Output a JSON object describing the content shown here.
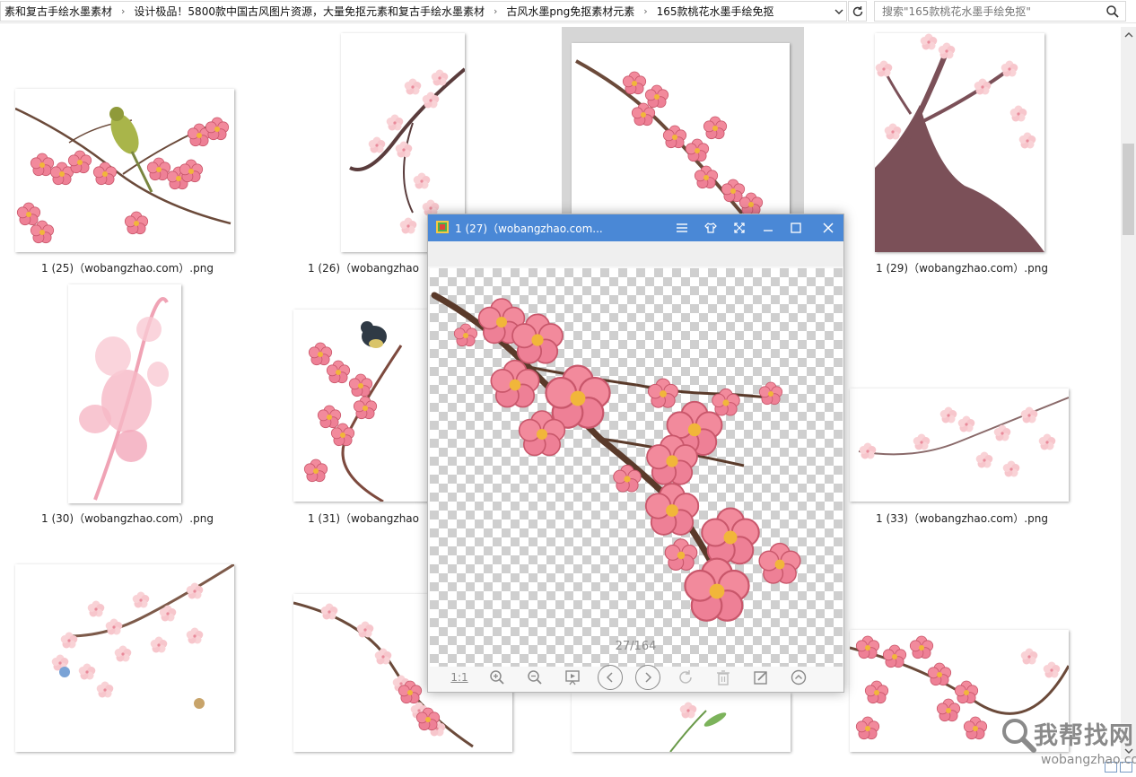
{
  "address_bar": {
    "breadcrumbs": [
      "素和复古手绘水墨素材",
      "设计极品！5800款中国古风图片资源，大量免抠元素和复古手绘水墨素材",
      "古风水墨png免抠素材元素",
      "165款桃花水墨手绘免抠"
    ],
    "search_placeholder": "搜索\"165款桃花水墨手绘免抠\""
  },
  "files": [
    {
      "label": "1 (25)（wobangzhao.com）.png"
    },
    {
      "label": "1 (26)（wobangzhao"
    },
    {
      "label": "1 (29)（wobangzhao.com）.png"
    },
    {
      "label": "1 (30)（wobangzhao.com）.png"
    },
    {
      "label": "1 (31)（wobangzhao"
    },
    {
      "label": "1 (33)（wobangzhao.com）.png"
    }
  ],
  "viewer": {
    "title": "1 (27)（wobangzhao.com...",
    "counter": "27/164",
    "tools": {
      "actual_size": "1:1"
    },
    "colors": {
      "titlebar": "#4a88d6"
    }
  },
  "watermark": {
    "text": "我帮找网",
    "url": "wobangzhao.com"
  }
}
